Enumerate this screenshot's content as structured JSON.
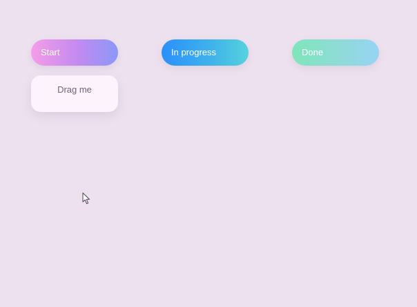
{
  "board": {
    "columns": [
      {
        "label": "Start",
        "cards": [
          {
            "label": "Drag me"
          }
        ]
      },
      {
        "label": "In progress",
        "cards": []
      },
      {
        "label": "Done",
        "cards": []
      }
    ]
  },
  "colors": {
    "background": "#ede1ef",
    "card_background": "#fdf3fd",
    "start_gradient": [
      "#f59ce8",
      "#8a98f7"
    ],
    "progress_gradient": [
      "#2a90fb",
      "#55d2dd"
    ],
    "done_gradient": [
      "#7ee6b9",
      "#97d4f4"
    ]
  },
  "cursor": {
    "icon": "mouse-pointer-icon"
  }
}
